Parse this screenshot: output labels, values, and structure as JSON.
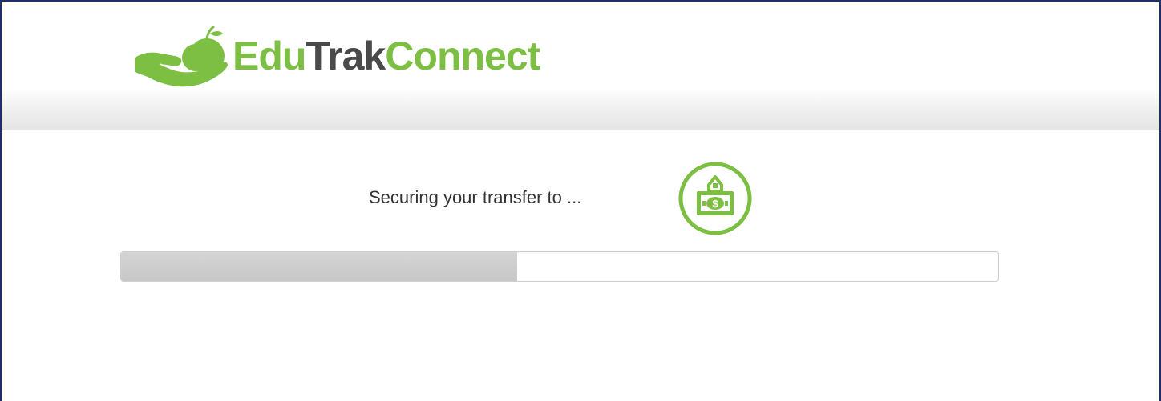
{
  "brand": {
    "part1": "Edu",
    "part2": "Trak",
    "part3": "Connect",
    "primary_color": "#7cbf43",
    "secondary_color": "#4a4a4a"
  },
  "transfer": {
    "status_text": "Securing your transfer to ...",
    "icon": "bank-money-icon",
    "progress_fraction": 0.452
  },
  "colors": {
    "frame_border": "#1f2f6b",
    "progress_fill": "#c8c8c8"
  }
}
